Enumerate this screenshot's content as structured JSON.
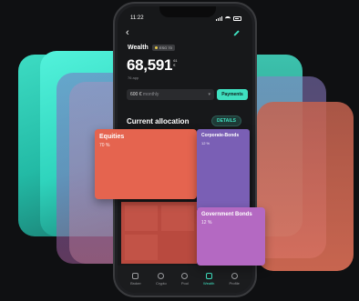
{
  "status_bar": {
    "time": "11:22"
  },
  "header": {
    "title": "Wealth",
    "badge": "ESG 70",
    "value_main": "68,591",
    "value_cents": "61",
    "value_currency": "€",
    "subtitle": "76 app"
  },
  "monthly": {
    "value": "600 €",
    "label": "monthly",
    "button": "Payments"
  },
  "allocation": {
    "title": "Current allocation",
    "details_label": "DETAILS",
    "tiles": [
      {
        "name": "Equities",
        "pct": "70 %",
        "color": "#e5644f"
      },
      {
        "name": "Corporate-Bonds",
        "pct": "12 %",
        "color": "#7a5fb5"
      },
      {
        "name": "Government Bonds",
        "pct": "12 %",
        "color": "#b469c2"
      }
    ]
  },
  "nav": {
    "items": [
      {
        "label": "Broker",
        "icon": "briefcase-icon"
      },
      {
        "label": "Crypto",
        "icon": "coin-icon"
      },
      {
        "label": "Pool",
        "icon": "drop-icon"
      },
      {
        "label": "Wealth",
        "icon": "wealth-icon",
        "active": true
      },
      {
        "label": "Profile",
        "icon": "person-icon"
      }
    ]
  },
  "colors": {
    "accent": "#3fe0c0",
    "equities": "#e5644f",
    "corporate": "#7a5fb5",
    "government": "#b469c2"
  }
}
